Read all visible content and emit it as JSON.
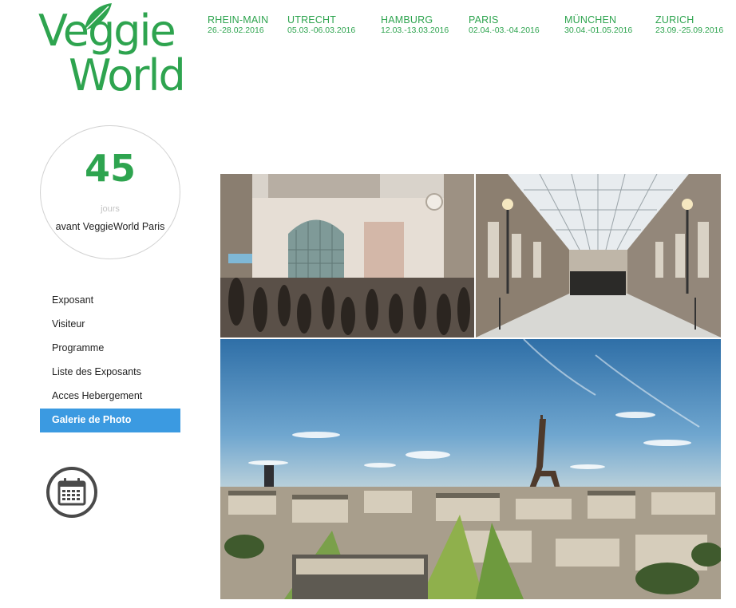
{
  "brand": {
    "logo_line1": "Veggie",
    "logo_line2": "World"
  },
  "colors": {
    "brand_green": "#2ea44f",
    "active_blue": "#3b9ae1",
    "circle_border": "#d2d2d2"
  },
  "events": [
    {
      "city": "RHEIN-MAIN",
      "dates": "26.-28.02.2016"
    },
    {
      "city": "UTRECHT",
      "dates": "05.03.-06.03.2016"
    },
    {
      "city": "HAMBURG",
      "dates": "12.03.-13.03.2016"
    },
    {
      "city": "PARIS",
      "dates": "02.04.-03.-04.2016"
    },
    {
      "city": "MÜNCHEN",
      "dates": "30.04.-01.05.2016"
    },
    {
      "city": "ZURICH",
      "dates": "23.09.-25.09.2016"
    }
  ],
  "countdown": {
    "number": "45",
    "unit": "jours",
    "caption": "avant VeggieWorld Paris"
  },
  "menu": [
    {
      "label": "Exposant"
    },
    {
      "label": "Visiteur"
    },
    {
      "label": "Programme"
    },
    {
      "label": "Liste des Exposants"
    },
    {
      "label": "Acces Hebergement"
    },
    {
      "label": "Galerie de Photo",
      "active": true
    }
  ],
  "icons": {
    "calendar": "calendar-icon",
    "logo_leaf": "leaf-icon"
  }
}
